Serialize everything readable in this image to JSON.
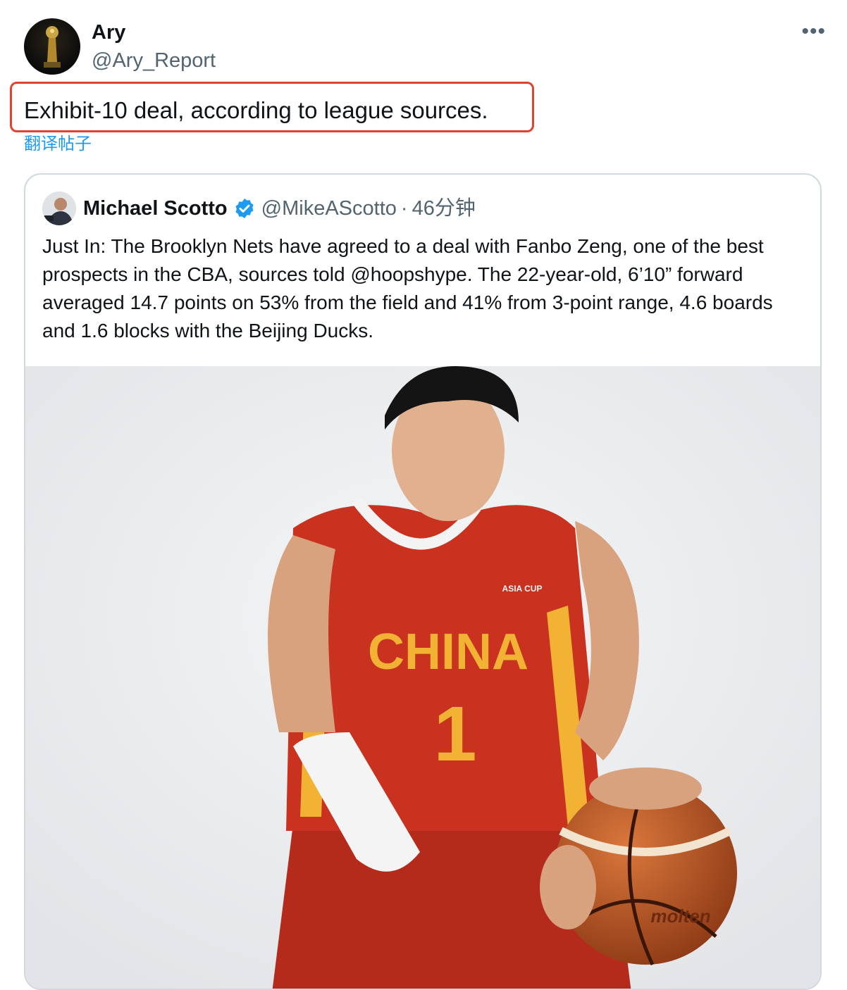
{
  "tweet": {
    "author_name": "Ary",
    "author_handle": "@Ary_Report",
    "more_icon": "more-horizontal-icon",
    "text": "Exhibit-10 deal, according to league sources.",
    "translate_link": "翻译帖子",
    "highlight_color": "#e0432f"
  },
  "quote": {
    "author_name": "Michael Scotto",
    "verified_icon": "verified-badge-icon",
    "author_handle": "@MikeAScotto",
    "separator": "·",
    "time": "46分钟",
    "text": "Just In: The Brooklyn Nets have agreed to a deal with Fanbo Zeng, one of the best prospects in the CBA, sources told @hoopshype. The 22-year-old, 6’10” forward averaged 14.7 points on 53% from the field and 41% from 3-point range, 4.6 boards and 1.6 blocks with the Beijing Ducks.",
    "photo": {
      "jersey_text": "CHINA",
      "jersey_number": "1",
      "ball_brand": "molten",
      "patch_text": "ASIA CUP"
    }
  },
  "colors": {
    "link": "#1d9bf0",
    "secondary_text": "#536471",
    "border": "#cfd9de",
    "jersey_red": "#c8321f",
    "jersey_gold": "#f2b234"
  }
}
